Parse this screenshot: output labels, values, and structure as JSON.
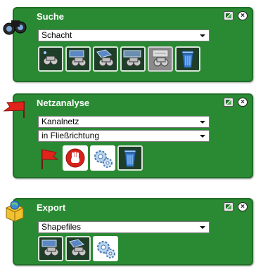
{
  "panels": [
    {
      "title": "Suche",
      "selects": [
        "Schacht"
      ],
      "tools": [
        {
          "icon": "binoculars-point-icon"
        },
        {
          "icon": "binoculars-rectangle-icon"
        },
        {
          "icon": "binoculars-polygon-icon"
        },
        {
          "icon": "binoculars-search-icon"
        },
        {
          "icon": "binoculars-attribute-icon",
          "selected": true
        },
        {
          "icon": "trash-icon"
        }
      ]
    },
    {
      "title": "Netzanalyse",
      "selects": [
        "Kanalnetz",
        "in Fließrichtung"
      ],
      "tools": [
        {
          "icon": "red-flag-icon"
        },
        {
          "icon": "stop-hand-icon"
        },
        {
          "icon": "gears-icon"
        },
        {
          "icon": "trash-icon"
        }
      ]
    },
    {
      "title": "Export",
      "selects": [
        "Shapefiles"
      ],
      "tools": [
        {
          "icon": "binoculars-rectangle-icon"
        },
        {
          "icon": "binoculars-polygon-icon"
        },
        {
          "icon": "gears-icon"
        }
      ]
    }
  ],
  "colors": {
    "panel_bg": "#2a8a34",
    "tool_bg": "#1e3e28"
  }
}
